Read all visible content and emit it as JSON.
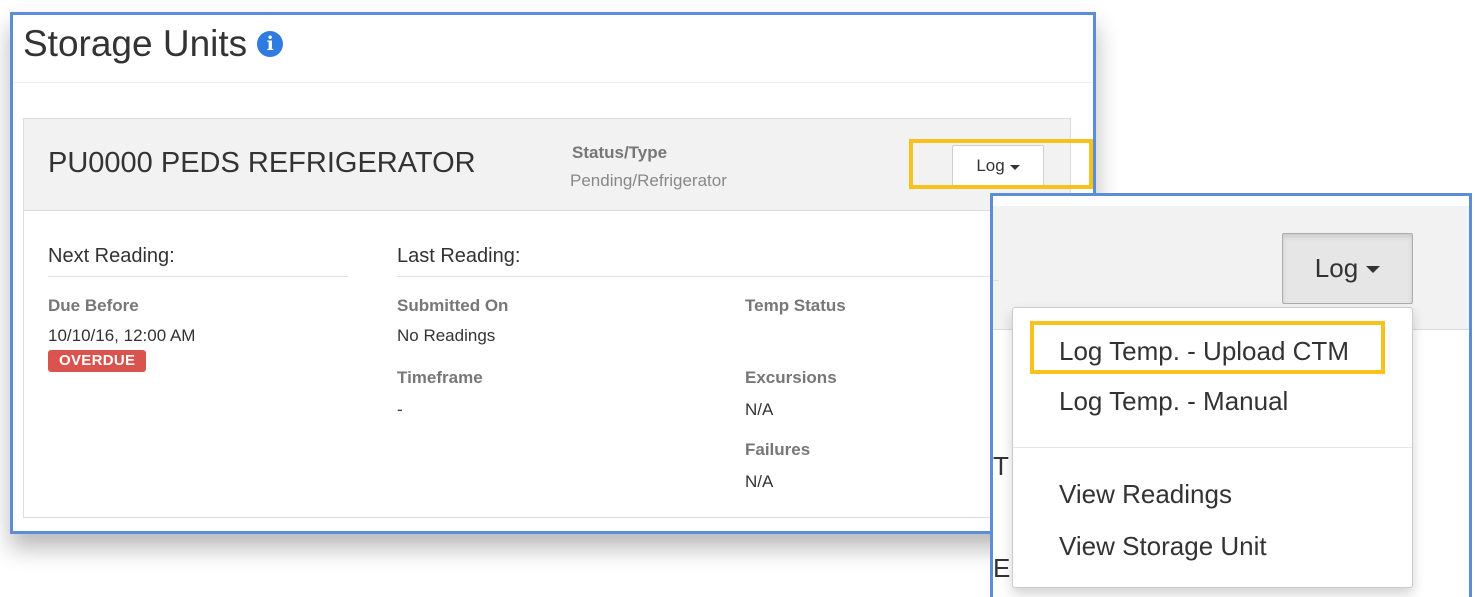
{
  "page": {
    "title": "Storage Units",
    "info_icon": "info-circle-icon"
  },
  "unit": {
    "name": "PU0000 PEDS REFRIGERATOR",
    "status_label": "Status/Type",
    "status_value": "Pending/Refrigerator",
    "log_button": "Log"
  },
  "next_reading": {
    "heading": "Next Reading:",
    "due_label": "Due Before",
    "due_value": "10/10/16, 12:00 AM",
    "badge": "OVERDUE"
  },
  "last_reading": {
    "heading": "Last Reading:",
    "submitted_label": "Submitted On",
    "submitted_value": "No Readings",
    "timeframe_label": "Timeframe",
    "timeframe_value": "-",
    "temp_status_label": "Temp Status",
    "excursions_label": "Excursions",
    "excursions_value": "N/A",
    "failures_label": "Failures",
    "failures_value": "N/A"
  },
  "zoom": {
    "log_button": "Log",
    "partial_text_1": "T",
    "partial_text_2": "E",
    "menu": {
      "items": [
        "Log Temp. - Upload CTM",
        "Log Temp. - Manual",
        "View Readings",
        "View Storage Unit"
      ]
    }
  },
  "colors": {
    "window_border": "#5b8ed6",
    "highlight": "#f6c21b",
    "overdue": "#d9534f",
    "info": "#2f7be0"
  }
}
